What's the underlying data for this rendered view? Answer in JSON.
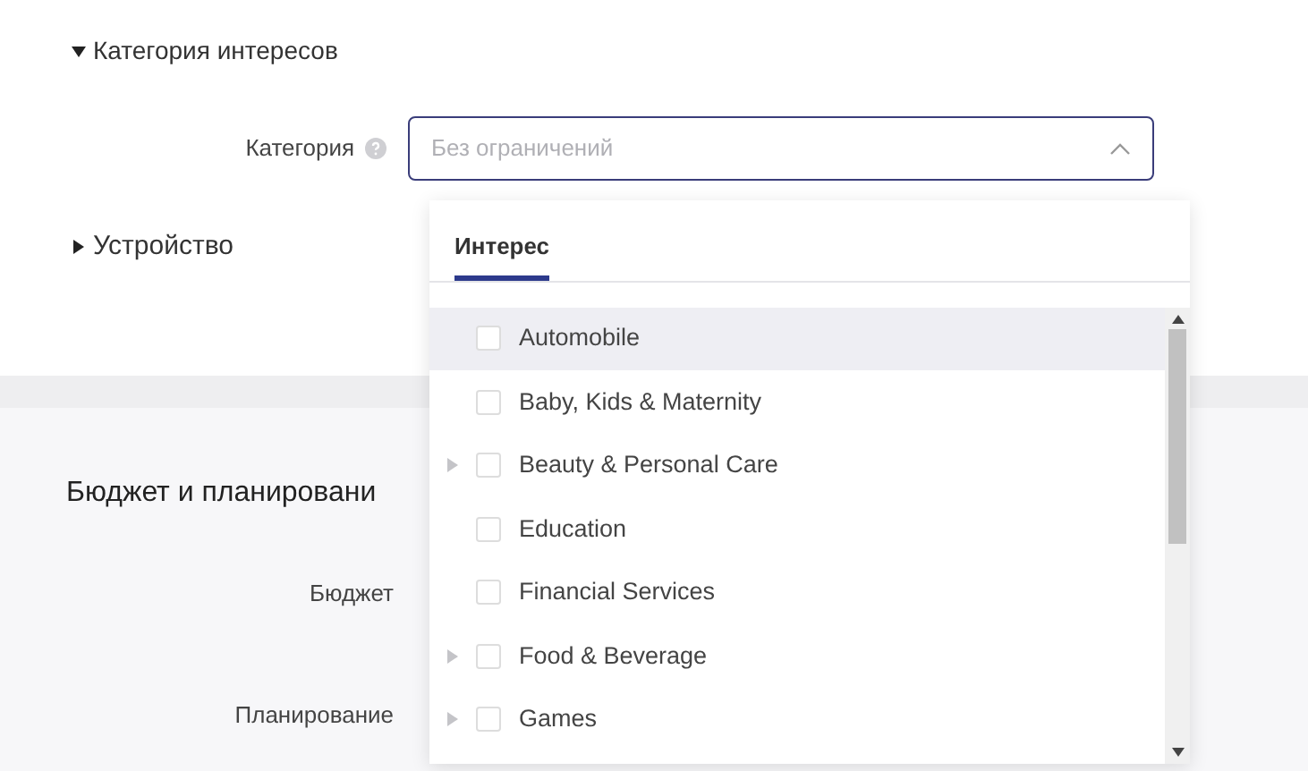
{
  "interest_section": {
    "title": "Категория интересов",
    "expanded": true
  },
  "category_field": {
    "label": "Категория",
    "placeholder": "Без ограничений",
    "open": true
  },
  "device_section": {
    "title": "Устройство",
    "expanded": false
  },
  "budget_section": {
    "title": "Бюджет и планировани",
    "fields": [
      "Бюджет",
      "Планирование"
    ]
  },
  "dropdown": {
    "tabs": [
      {
        "label": "Интерес",
        "selected": true
      }
    ],
    "items": [
      {
        "label": "Automobile",
        "expandable": false,
        "checked": false,
        "hovered": true
      },
      {
        "label": "Baby, Kids & Maternity",
        "expandable": false,
        "checked": false,
        "hovered": false
      },
      {
        "label": "Beauty & Personal Care",
        "expandable": true,
        "checked": false,
        "hovered": false
      },
      {
        "label": "Education",
        "expandable": false,
        "checked": false,
        "hovered": false
      },
      {
        "label": "Financial Services",
        "expandable": false,
        "checked": false,
        "hovered": false
      },
      {
        "label": "Food & Beverage",
        "expandable": true,
        "checked": false,
        "hovered": false
      },
      {
        "label": "Games",
        "expandable": true,
        "checked": false,
        "hovered": false
      }
    ]
  }
}
